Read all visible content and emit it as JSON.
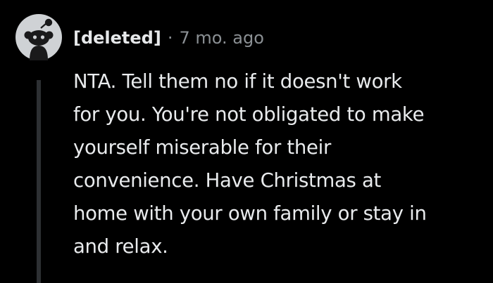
{
  "comment": {
    "avatar_icon": "reddit-snoo-avatar-icon",
    "author": "[deleted]",
    "separator": "·",
    "timestamp": "7 mo. ago",
    "body_lines": [
      "NTA. Tell them no if it doesn't work",
      "for you. You're not obligated to make",
      "yourself miserable for their",
      "convenience. Have Christmas at",
      "home with your own family or stay in",
      "and relax."
    ]
  },
  "colors": {
    "background": "#000000",
    "text": "#e9ebed",
    "meta_text": "#8b9094",
    "thread_line": "#2d3033",
    "avatar_bg": "#cfd2d5"
  }
}
